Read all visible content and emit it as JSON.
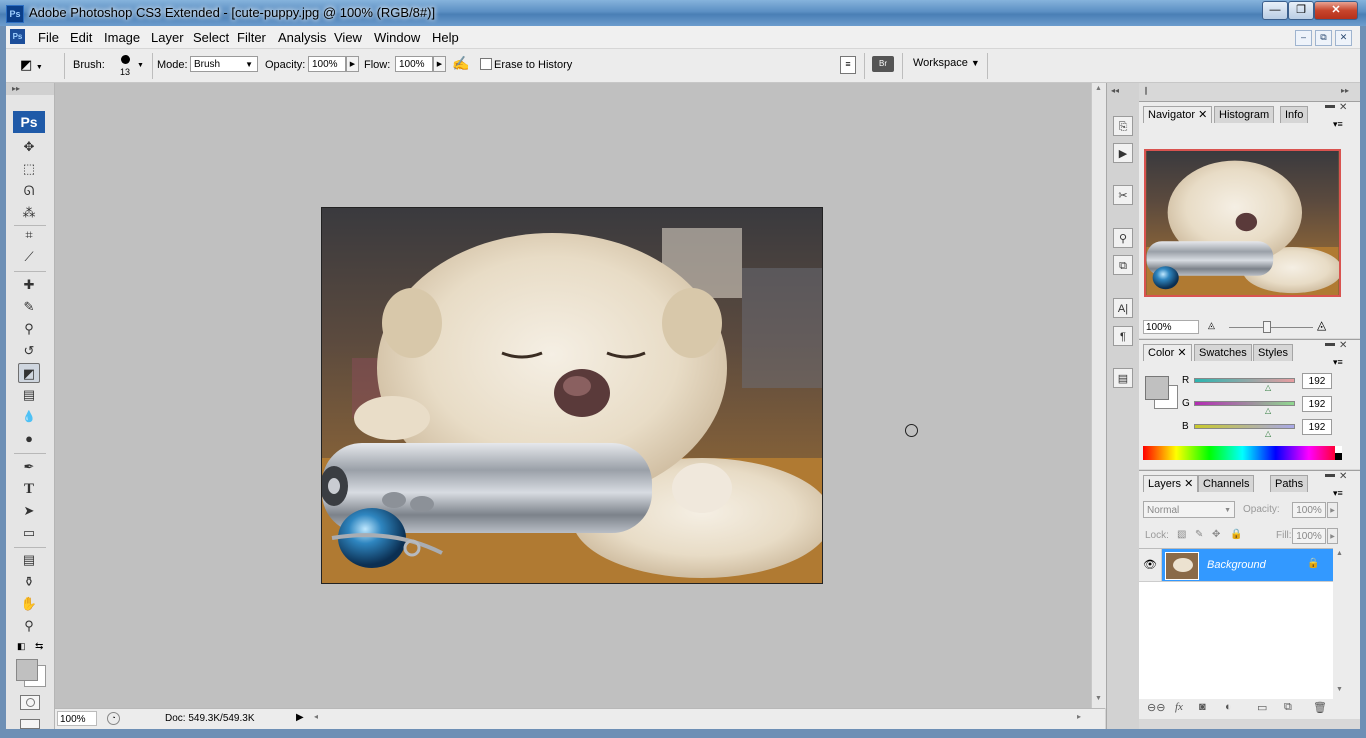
{
  "window": {
    "title": "Adobe Photoshop CS3 Extended - [cute-puppy.jpg @ 100% (RGB/8#)]",
    "app_icon": "Ps",
    "controls": [
      "—",
      "❐",
      "✕"
    ]
  },
  "menu": {
    "items": [
      "File",
      "Edit",
      "Image",
      "Layer",
      "Select",
      "Filter",
      "Analysis",
      "View",
      "Window",
      "Help"
    ],
    "mdi_controls": [
      "–",
      "⧉",
      "✕"
    ]
  },
  "options_bar": {
    "brush_label": "Brush:",
    "brush_size": "13",
    "mode_label": "Mode:",
    "mode_value": "Brush",
    "opacity_label": "Opacity:",
    "opacity_value": "100%",
    "flow_label": "Flow:",
    "flow_value": "100%",
    "erase_history_label": "Erase to History",
    "erase_history_checked": false,
    "workspace_label": "Workspace"
  },
  "toolbox": {
    "logo": "Ps",
    "tools": [
      {
        "name": "move-tool-icon",
        "glyph": "✥"
      },
      {
        "name": "marquee-tool-icon",
        "glyph": "⬚"
      },
      {
        "name": "lasso-tool-icon",
        "glyph": "ᘏ"
      },
      {
        "name": "magic-wand-tool-icon",
        "glyph": "⁂"
      },
      {
        "name": "crop-tool-icon",
        "glyph": "⌗"
      },
      {
        "name": "slice-tool-icon",
        "glyph": "⟋"
      },
      {
        "name": "healing-brush-tool-icon",
        "glyph": "✚"
      },
      {
        "name": "brush-tool-icon",
        "glyph": "✎"
      },
      {
        "name": "clone-stamp-tool-icon",
        "glyph": "⚲"
      },
      {
        "name": "history-brush-tool-icon",
        "glyph": "↺"
      },
      {
        "name": "eraser-tool-icon",
        "glyph": "◩",
        "active": true
      },
      {
        "name": "gradient-tool-icon",
        "glyph": "▤"
      },
      {
        "name": "blur-tool-icon",
        "glyph": "💧"
      },
      {
        "name": "dodge-tool-icon",
        "glyph": "●"
      },
      {
        "name": "pen-tool-icon",
        "glyph": "✒"
      },
      {
        "name": "type-tool-icon",
        "glyph": "T"
      },
      {
        "name": "path-selection-tool-icon",
        "glyph": "➤"
      },
      {
        "name": "shape-tool-icon",
        "glyph": "▭"
      },
      {
        "name": "notes-tool-icon",
        "glyph": "▤"
      },
      {
        "name": "eyedropper-tool-icon",
        "glyph": "⚱"
      },
      {
        "name": "hand-tool-icon",
        "glyph": "✋"
      },
      {
        "name": "zoom-tool-icon",
        "glyph": "⚲"
      }
    ]
  },
  "status_bar": {
    "zoom": "100%",
    "doc_info": "Doc: 549.3K/549.3K"
  },
  "navigator": {
    "tabs": [
      "Navigator",
      "Histogram",
      "Info"
    ],
    "zoom": "100%"
  },
  "color_panel": {
    "tabs": [
      "Color",
      "Swatches",
      "Styles"
    ],
    "channels": [
      {
        "label": "R",
        "value": "192",
        "slider_color": "#2fbfb8"
      },
      {
        "label": "G",
        "value": "192",
        "slider_color": "#b43ab4"
      },
      {
        "label": "B",
        "value": "192",
        "slider_color": "#c9c636"
      }
    ],
    "foreground_color": "#c0c0c0"
  },
  "layers_panel": {
    "tabs": [
      "Layers",
      "Channels",
      "Paths"
    ],
    "blend_mode": "Normal",
    "opacity_label": "Opacity:",
    "opacity_value": "100%",
    "lock_label": "Lock:",
    "fill_label": "Fill:",
    "fill_value": "100%",
    "layers": [
      {
        "name": "Background",
        "selected": true,
        "locked": true
      }
    ]
  },
  "colors": {
    "canvas_bg": "#c0c0c0",
    "selection_blue": "#3399ff"
  }
}
